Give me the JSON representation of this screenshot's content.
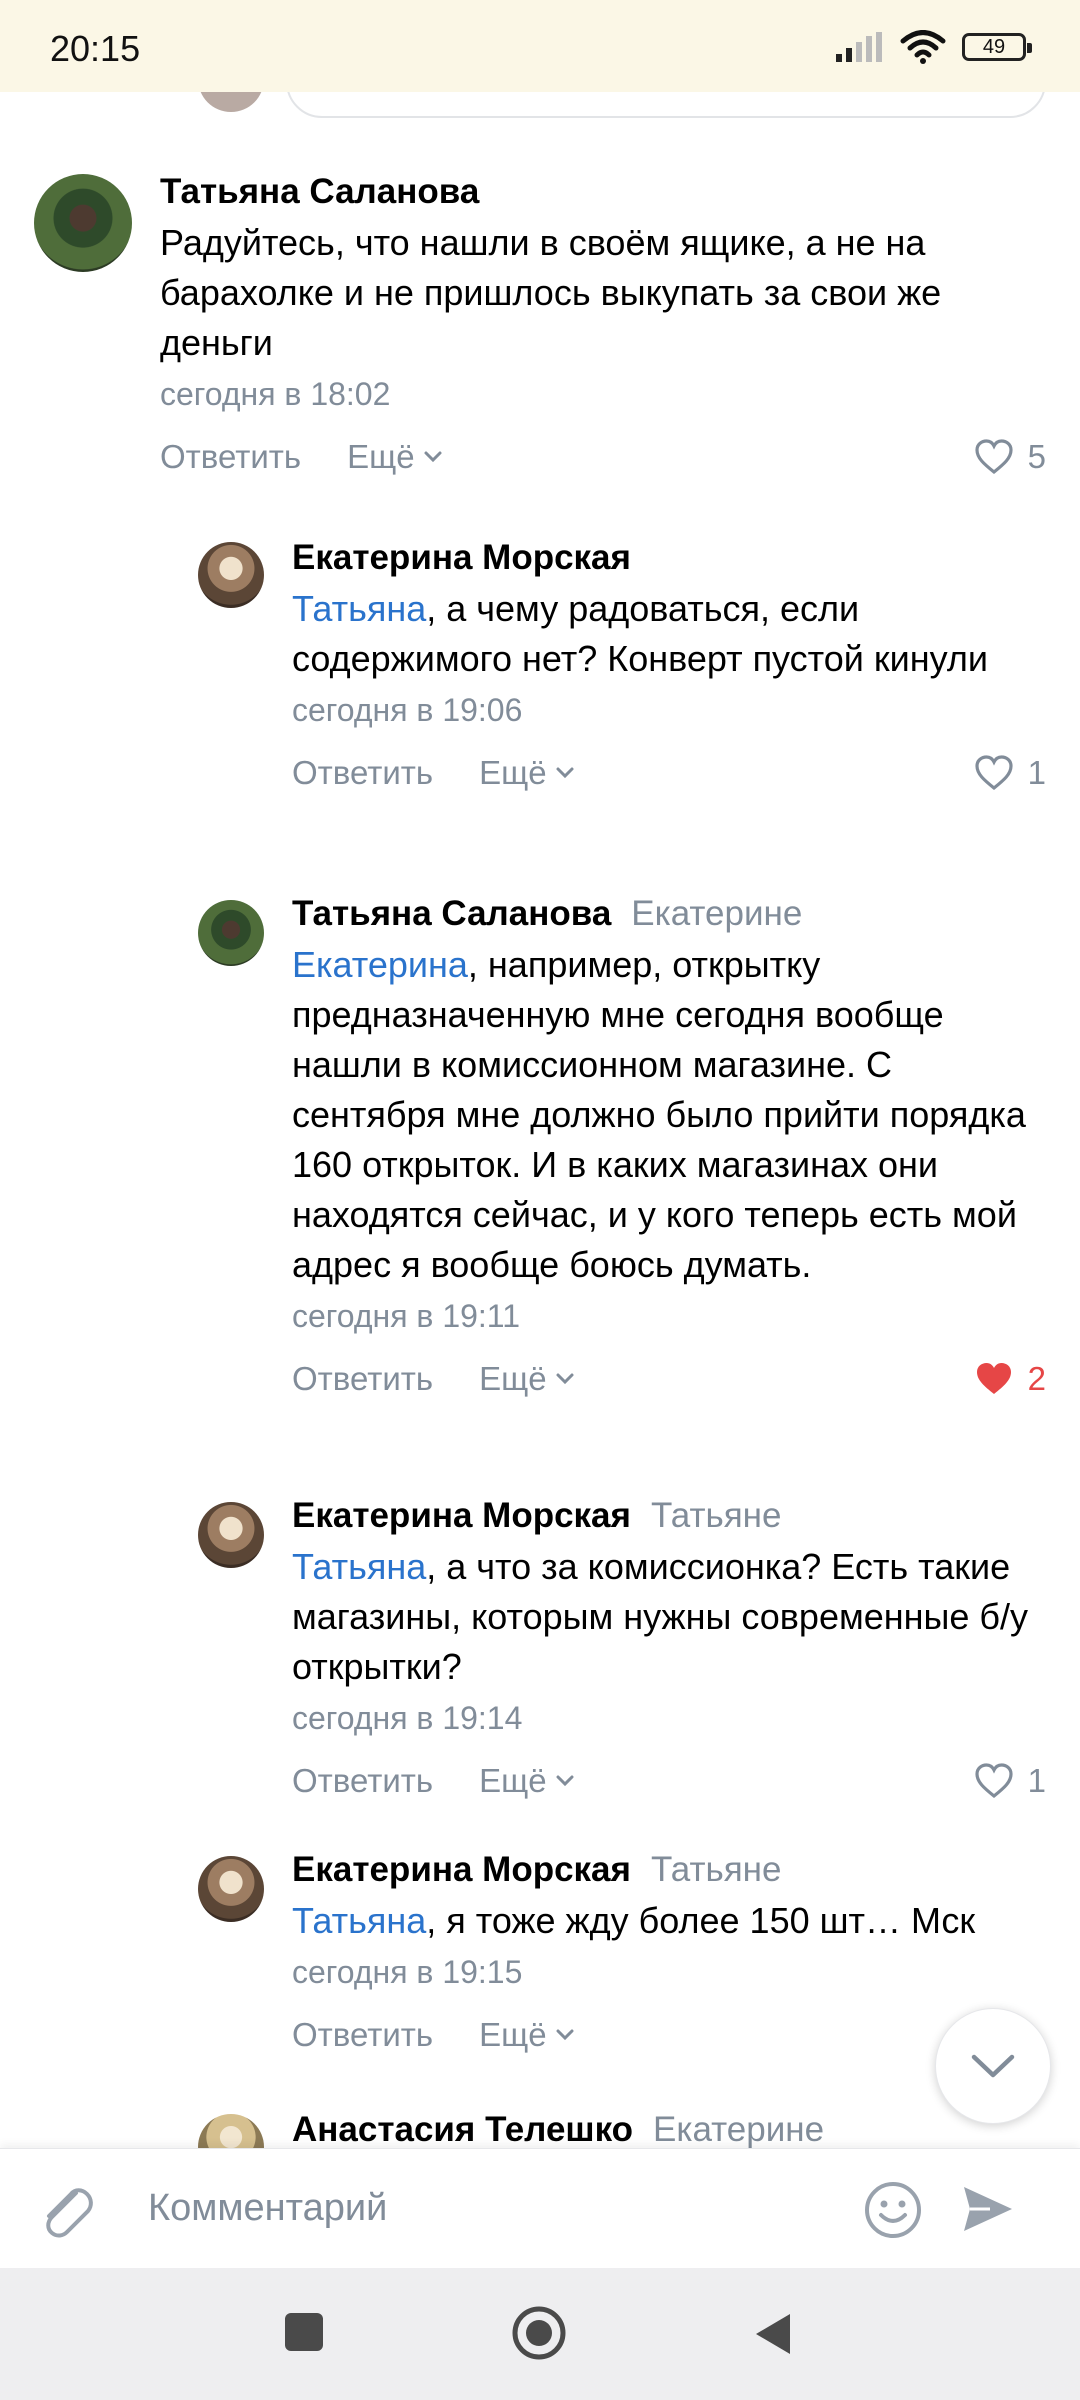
{
  "status_bar": {
    "time": "20:15",
    "battery": "49"
  },
  "comments": [
    {
      "author": "Татьяна Саланова",
      "reply_to": "",
      "mention": "",
      "text": "Радуйтесь, что нашли в своём ящике, а не на барахолке и не пришлось выкупать за свои же деньги",
      "time": "сегодня в 18:02",
      "likes": "5",
      "liked": false
    },
    {
      "author": "Екатерина Морская",
      "reply_to": "",
      "mention": "Татьяна",
      "text": ", а чему радоваться, если содержимого нет? Конверт пустой кинули",
      "time": "сегодня в 19:06",
      "likes": "1",
      "liked": false
    },
    {
      "author": "Татьяна Саланова",
      "reply_to": "Екатерине",
      "mention": "Екатерина",
      "text": ", например, открытку предназначенную мне сегодня вообще нашли в комиссионном магазине. С сентября мне должно было прийти порядка 160 открыток. И в каких магазинах они находятся сейчас, и у кого теперь есть мой адрес я вообще боюсь думать.",
      "time": "сегодня в 19:11",
      "likes": "2",
      "liked": true
    },
    {
      "author": "Екатерина Морская",
      "reply_to": "Татьяне",
      "mention": "Татьяна",
      "text": ", а что за комиссионка? Есть такие магазины, которым нужны современные б/у открытки?",
      "time": "сегодня в 19:14",
      "likes": "1",
      "liked": false
    },
    {
      "author": "Екатерина Морская",
      "reply_to": "Татьяне",
      "mention": "Татьяна",
      "text": ", я тоже жду более 150 шт… Мск",
      "time": "сегодня в 19:15",
      "likes": "",
      "liked": false
    },
    {
      "author": "Анастасия Телешко",
      "reply_to": "Екатерине"
    }
  ],
  "actions": {
    "reply": "Ответить",
    "more": "Ещё"
  },
  "composer": {
    "placeholder": "Комментарий"
  },
  "icons": {
    "like": "heart-outline-icon",
    "liked": "heart-filled-icon",
    "attach": "paperclip-icon",
    "emoji": "smile-icon",
    "send": "send-icon",
    "scroll": "chevron-down-icon"
  },
  "colors": {
    "link": "#2a73cc",
    "secondary": "#818c99",
    "like_active": "#e64646",
    "status_bar_bg": "#fbf7e6"
  }
}
